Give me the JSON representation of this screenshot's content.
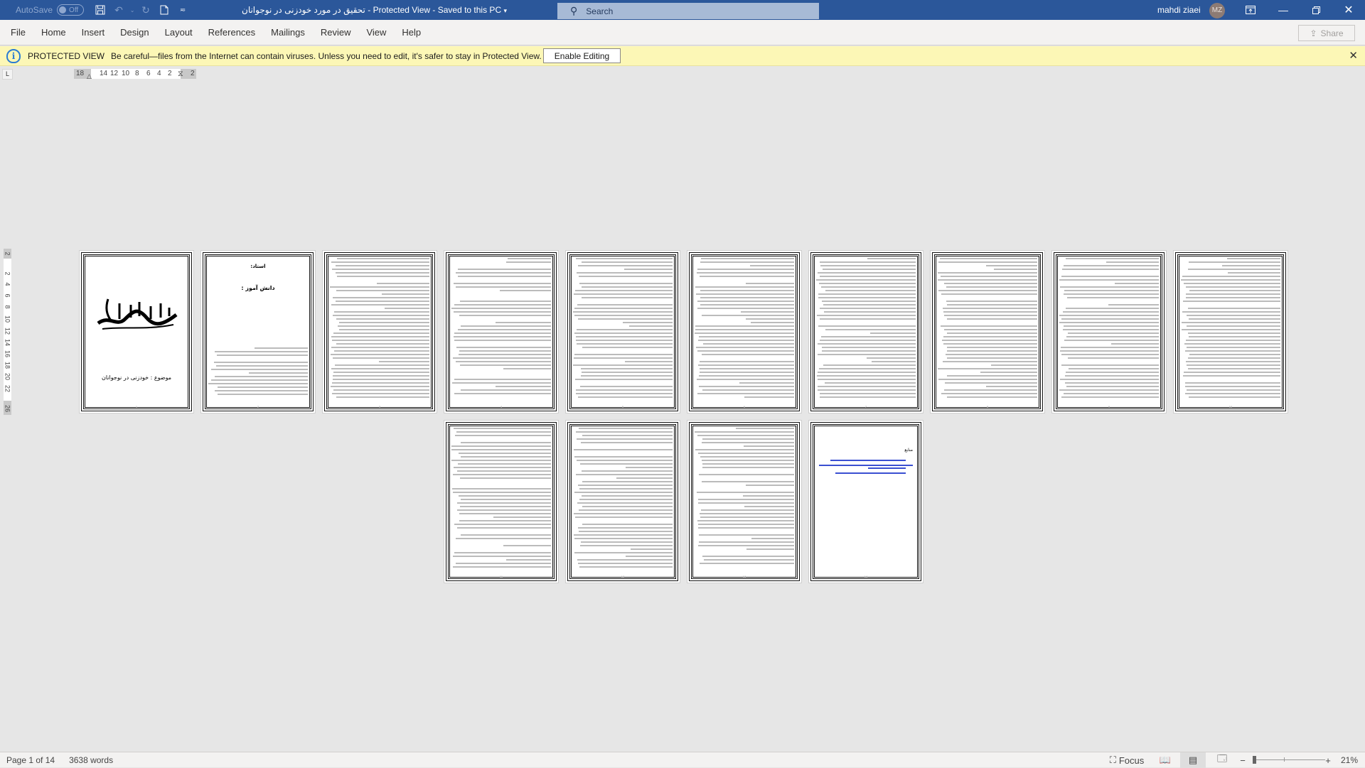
{
  "titlebar": {
    "autosave_label": "AutoSave",
    "autosave_state": "Off",
    "doc_title": "تحقیق در مورد خودزنی در نوجوانان  -  Protected View  -  Saved to this PC",
    "saved_dropdown_icon": "chevron-down-icon",
    "search_placeholder": "Search",
    "user_name": "mahdi ziaei",
    "user_initials": "MZ",
    "accent_color": "#2b579a"
  },
  "ribbon": {
    "tabs": [
      {
        "label": "File"
      },
      {
        "label": "Home"
      },
      {
        "label": "Insert"
      },
      {
        "label": "Design"
      },
      {
        "label": "Layout"
      },
      {
        "label": "References"
      },
      {
        "label": "Mailings"
      },
      {
        "label": "Review"
      },
      {
        "label": "View"
      },
      {
        "label": "Help"
      }
    ],
    "share_label": "Share"
  },
  "protected_view": {
    "title": "PROTECTED VIEW",
    "message": "Be careful—files from the Internet can contain viruses. Unless you need to edit, it's safer to stay in Protected View.",
    "enable_button": "Enable Editing",
    "bar_color": "#fcf7b6"
  },
  "ruler": {
    "horizontal_ticks": [
      "18",
      "14",
      "12",
      "10",
      "8",
      "6",
      "4",
      "2",
      "2"
    ],
    "vertical_ticks": [
      "2",
      "2",
      "4",
      "6",
      "8",
      "10",
      "12",
      "14",
      "16",
      "18",
      "20",
      "22",
      "26"
    ],
    "tab_selector": "L"
  },
  "document": {
    "page1": {
      "basmala": "بسم الله الرحمن الرحیم",
      "subject": "موضوع : خودزنی در نوجوانان"
    },
    "page2": {
      "teacher_label": "استاد:",
      "student_label": "دانش آموز :"
    },
    "page14": {
      "references_heading": "منابع"
    },
    "total_pages": 14
  },
  "statusbar": {
    "page_info": "Page 1 of 14",
    "word_count": "3638 words",
    "focus_label": "Focus",
    "zoom_level": "21%",
    "zoom_minus": "−",
    "zoom_plus": "+"
  }
}
